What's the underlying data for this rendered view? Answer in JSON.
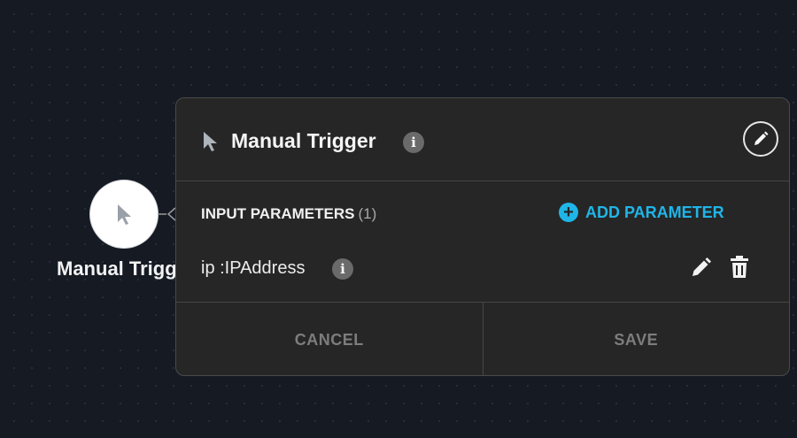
{
  "node": {
    "label": "Manual Trigger",
    "icon": "cursor-icon"
  },
  "panel": {
    "title": "Manual Trigger",
    "info_glyph": "i",
    "title_icon": "cursor-icon",
    "edit_icon": "pencil-icon"
  },
  "parameters": {
    "section_title": "INPUT PARAMETERS",
    "count": "(1)",
    "add_label": "ADD PARAMETER",
    "add_icon": "plus-circle-icon",
    "items": [
      {
        "name": "ip :IPAddress",
        "info_glyph": "i"
      }
    ]
  },
  "footer": {
    "cancel_label": "CANCEL",
    "save_label": "SAVE"
  },
  "colors": {
    "accent": "#20b5e8",
    "canvas_bg": "#151a23",
    "panel_bg": "#262626"
  }
}
